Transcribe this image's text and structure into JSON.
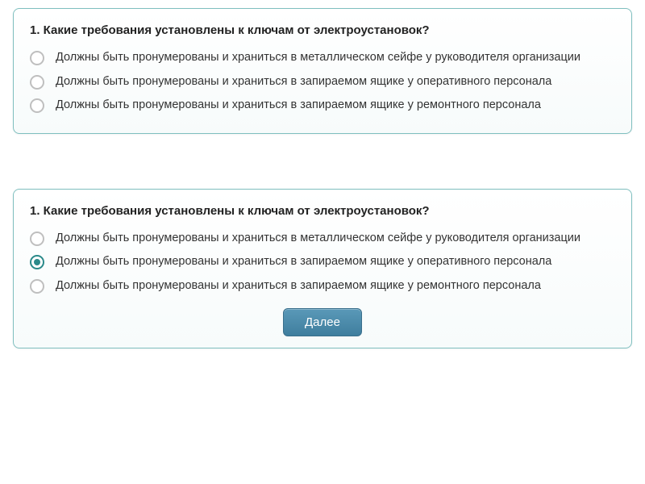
{
  "quiz1": {
    "question": "1. Какие требования установлены к ключам от электроустановок?",
    "options": [
      "Должны быть пронумерованы и храниться в металлическом сейфе у руководителя организации",
      "Должны быть пронумерованы и храниться в запираемом ящике у оперативного персонала",
      "Должны быть пронумерованы и храниться в запираемом ящике у ремонтного персонала"
    ],
    "selected": null
  },
  "quiz2": {
    "question": "1. Какие требования установлены к ключам от электроустановок?",
    "options": [
      "Должны быть пронумерованы и храниться в металлическом сейфе у руководителя организации",
      "Должны быть пронумерованы и храниться в запираемом ящике у оперативного персонала",
      "Должны быть пронумерованы и храниться в запираемом ящике у ремонтного персонала"
    ],
    "selected": 1,
    "next_label": "Далее"
  }
}
